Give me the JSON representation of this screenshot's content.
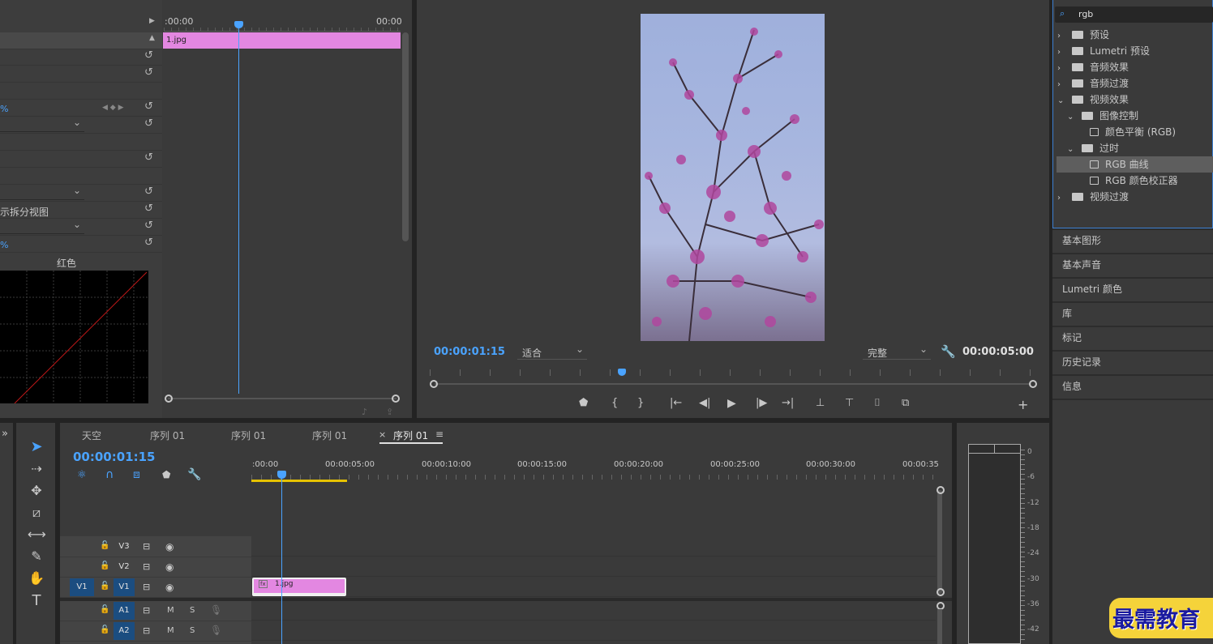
{
  "effect_controls": {
    "ruler_start": ":00:00",
    "ruler_end": "00:00",
    "clip_label": "1.jpg",
    "pct1": "%",
    "pct2": "%",
    "split_view_label": "示拆分视图",
    "channel_label": "红色"
  },
  "program_monitor": {
    "timecode": "00:00:01:15",
    "fit_value": "适合",
    "quality_value": "完整",
    "duration": "00:00:05:00",
    "controls": [
      "marker",
      "mark-in",
      "mark-out",
      "go-to-in",
      "step-back",
      "play",
      "step-forward",
      "go-to-out",
      "lift",
      "extract",
      "export-frame",
      "compare"
    ]
  },
  "effects_panel": {
    "search_value": "rgb",
    "tree": [
      {
        "label": "预设",
        "type": "folder",
        "level": 0,
        "expanded": false
      },
      {
        "label": "Lumetri 预设",
        "type": "folder",
        "level": 0,
        "expanded": false
      },
      {
        "label": "音频效果",
        "type": "folder",
        "level": 0,
        "expanded": false
      },
      {
        "label": "音频过渡",
        "type": "folder",
        "level": 0,
        "expanded": false
      },
      {
        "label": "视频效果",
        "type": "folder",
        "level": 0,
        "expanded": true
      },
      {
        "label": "图像控制",
        "type": "folder",
        "level": 1,
        "expanded": true
      },
      {
        "label": "颜色平衡 (RGB)",
        "type": "effect",
        "level": 2
      },
      {
        "label": "过时",
        "type": "folder",
        "level": 1,
        "expanded": true
      },
      {
        "label": "RGB 曲线",
        "type": "effect",
        "level": 2,
        "selected": true
      },
      {
        "label": "RGB 颜色校正器",
        "type": "effect",
        "level": 2
      },
      {
        "label": "视频过渡",
        "type": "folder",
        "level": 0,
        "expanded": false
      }
    ],
    "panels": [
      "基本图形",
      "基本声音",
      "Lumetri 颜色",
      "库",
      "标记",
      "历史记录",
      "信息"
    ]
  },
  "timeline": {
    "tabs": [
      "天空",
      "序列 01",
      "序列 01",
      "序列 01",
      "序列 01"
    ],
    "active_tab": 4,
    "close_glyph": "×",
    "menu_glyph": "≡",
    "timecode": "00:00:01:15",
    "ruler": [
      ":00:00",
      "00:00:05:00",
      "00:00:10:00",
      "00:00:15:00",
      "00:00:20:00",
      "00:00:25:00",
      "00:00:30:00",
      "00:00:35"
    ],
    "tracks": [
      {
        "name": "V3",
        "source": ""
      },
      {
        "name": "V2",
        "source": ""
      },
      {
        "name": "V1",
        "source": "V1"
      },
      {
        "name": "A1",
        "source": "",
        "m": "M",
        "s": "S"
      },
      {
        "name": "A2",
        "source": "",
        "m": "M",
        "s": "S"
      }
    ],
    "clip_label": "1.jpg"
  },
  "audio_meter": {
    "ticks": [
      "0",
      "-6",
      "-12",
      "-18",
      "-24",
      "-30",
      "-36",
      "-42"
    ]
  },
  "watermark": "最需教育",
  "colors": {
    "accent": "#4aa3ff",
    "clip": "#e387e1",
    "playhead": "#4aa3ff",
    "in_out_bar": "#e6c200"
  }
}
